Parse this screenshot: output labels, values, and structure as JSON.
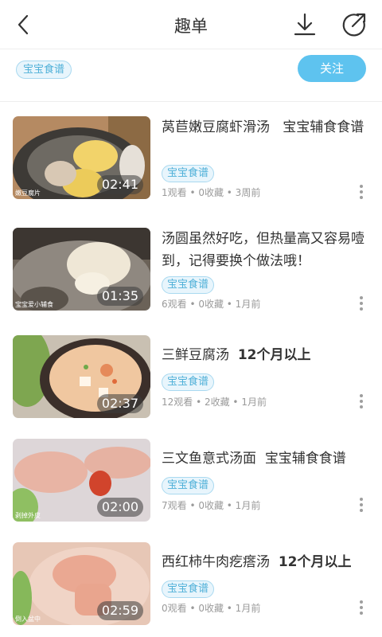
{
  "header": {
    "title": "趣单"
  },
  "collection": {
    "tag": "宝宝食谱",
    "follow_label": "关注"
  },
  "videos": [
    {
      "title": "莴苣嫩豆腐虾滑汤",
      "title_extra": "宝宝辅食食谱",
      "tag": "宝宝食谱",
      "meta": "1观看 • 0收藏 • 3周前",
      "duration": "02:41",
      "thumb_caption": "嫩豆腐片"
    },
    {
      "title": "汤圆虽然好吃，但热量高又容易噎到，记得要换个做法哦！",
      "title_extra": "",
      "tag": "宝宝食谱",
      "meta": "6观看 • 0收藏 • 1月前",
      "duration": "01:35",
      "thumb_caption": "宝宝爱小辅食"
    },
    {
      "title": "三鲜豆腐汤",
      "title_extra": "12个月以上",
      "tag": "宝宝食谱",
      "meta": "12观看 • 2收藏 • 1月前",
      "duration": "02:37",
      "thumb_caption": ""
    },
    {
      "title": "三文鱼意式汤面",
      "title_extra": "宝宝辅食食谱",
      "tag": "宝宝食谱",
      "meta": "7观看 • 0收藏 • 1月前",
      "duration": "02:00",
      "thumb_caption": "剥掉外皮"
    },
    {
      "title": "西红柿牛肉疙瘩汤",
      "title_extra": "12个月以上",
      "tag": "宝宝食谱",
      "meta": "0观看 • 0收藏 • 1月前",
      "duration": "02:59",
      "thumb_caption": "倒入盆中"
    }
  ]
}
